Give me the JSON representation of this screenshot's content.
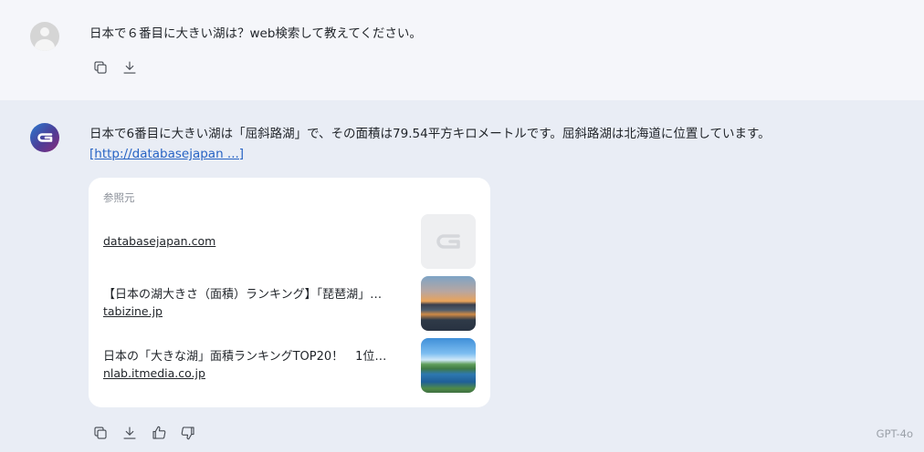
{
  "user_message": {
    "text": "日本で６番目に大きい湖は？web検索して教えてください。",
    "actions": [
      {
        "icon": "copy-icon"
      },
      {
        "icon": "download-icon"
      }
    ]
  },
  "assistant_message": {
    "text": "日本で6番目に大きい湖は「屈斜路湖」で、その面積は79.54平方キロメートルです。屈斜路湖は北海道に位置しています。",
    "link_text": "[http://databasejapan ...]",
    "references": {
      "title": "参照元",
      "items": [
        {
          "title": "",
          "domain": "databasejapan.com",
          "thumb": "g-logo-icon"
        },
        {
          "title": "【日本の湖大きさ（面積）ランキング】「琵琶湖」…",
          "domain": "tabizine.jp",
          "thumb": "sunset-lake-image"
        },
        {
          "title": "日本の「大きな湖」面積ランキングTOP20！　1位…",
          "domain": "nlab.itmedia.co.jp",
          "thumb": "blue-lake-image"
        }
      ]
    },
    "actions": [
      {
        "icon": "copy-icon"
      },
      {
        "icon": "download-icon"
      },
      {
        "icon": "thumbs-up-icon"
      },
      {
        "icon": "thumbs-down-icon"
      }
    ],
    "model": "GPT-4o"
  }
}
